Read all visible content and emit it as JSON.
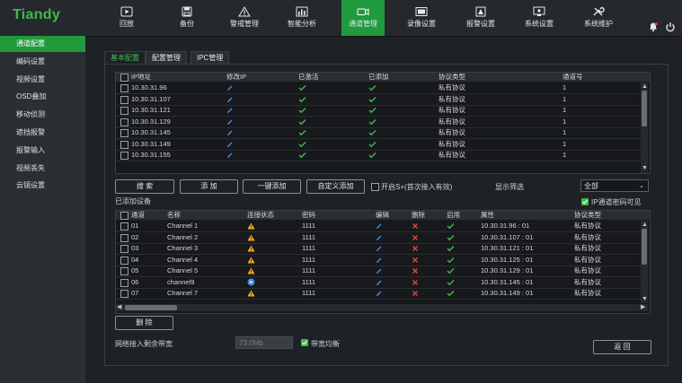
{
  "app": {
    "logo": "Tiandy"
  },
  "nav": {
    "items": [
      {
        "label": "回放",
        "icon": "playback-icon"
      },
      {
        "label": "备份",
        "icon": "save-icon"
      },
      {
        "label": "警戒管理",
        "icon": "alarm-icon"
      },
      {
        "label": "智能分析",
        "icon": "analysis-icon"
      },
      {
        "label": "通道管理",
        "icon": "camera-icon",
        "active": true
      },
      {
        "label": "录像设置",
        "icon": "record-icon"
      },
      {
        "label": "报警设置",
        "icon": "alarm-settings-icon"
      },
      {
        "label": "系统设置",
        "icon": "system-icon"
      },
      {
        "label": "系统维护",
        "icon": "maintenance-icon"
      }
    ],
    "bell_icon": "bell-icon",
    "power_icon": "power-icon"
  },
  "sidebar": {
    "items": [
      "通道配置",
      "编码设置",
      "视频设置",
      "OSD叠加",
      "移动侦测",
      "遮挡报警",
      "报警输入",
      "视频丢失",
      "云镜设置"
    ]
  },
  "tabs": [
    "基本配置",
    "配置管理",
    "IPC管理"
  ],
  "discovered": {
    "headers": [
      "IP地址",
      "修改IP",
      "已激活",
      "已添加",
      "协议类型",
      "通道号"
    ],
    "rows": [
      {
        "ip": "10.30.31.96",
        "protocol": "私有协议",
        "channel": "1"
      },
      {
        "ip": "10.30.31.107",
        "protocol": "私有协议",
        "channel": "1"
      },
      {
        "ip": "10.30.31.121",
        "protocol": "私有协议",
        "channel": "1"
      },
      {
        "ip": "10.30.31.129",
        "protocol": "私有协议",
        "channel": "1"
      },
      {
        "ip": "10.30.31.145",
        "protocol": "私有协议",
        "channel": "1"
      },
      {
        "ip": "10.30.31.149",
        "protocol": "私有协议",
        "channel": "1"
      },
      {
        "ip": "10.30.31.155",
        "protocol": "私有协议",
        "channel": "1"
      }
    ]
  },
  "buttons": {
    "search": "搜 索",
    "add": "添 加",
    "one_click_add": "一键添加",
    "custom_add": "自定义添加",
    "delete": "删 除",
    "back": "返 回"
  },
  "options": {
    "enable_s_plus": "开启S+(首次接入有效)",
    "display_filter": "显示筛选",
    "filter_value": "全部",
    "ip_password_visible": "IP通道密码可见",
    "bandwidth_balance": "带宽均衡"
  },
  "added": {
    "title": "已添加设备",
    "headers": [
      "通道",
      "名称",
      "连接状态",
      "密码",
      "编辑",
      "删除",
      "启用",
      "属性",
      "协议类型"
    ],
    "rows": [
      {
        "ch": "01",
        "name": "Channel 1",
        "status": "warning",
        "password": "1111",
        "attr": "10.30.31.96 : 01",
        "protocol": "私有协议"
      },
      {
        "ch": "02",
        "name": "Channel 2",
        "status": "warning",
        "password": "1111",
        "attr": "10.30.31.107 : 01",
        "protocol": "私有协议"
      },
      {
        "ch": "03",
        "name": "Channel 3",
        "status": "warning",
        "password": "1111",
        "attr": "10.30.31.121 : 01",
        "protocol": "私有协议"
      },
      {
        "ch": "04",
        "name": "Channel 4",
        "status": "warning",
        "password": "1111",
        "attr": "10.30.31.125 : 01",
        "protocol": "私有协议"
      },
      {
        "ch": "05",
        "name": "Channel 5",
        "status": "warning",
        "password": "1111",
        "attr": "10.30.31.129 : 01",
        "protocol": "私有协议"
      },
      {
        "ch": "06",
        "name": "channel9",
        "status": "playing",
        "password": "1111",
        "attr": "10.30.31.145 : 01",
        "protocol": "私有协议"
      },
      {
        "ch": "07",
        "name": "Channel 7",
        "status": "warning",
        "password": "1111",
        "attr": "10.30.31.149 : 01",
        "protocol": "私有协议"
      }
    ]
  },
  "bandwidth": {
    "label": "网络接入剩余带宽",
    "value": "73.0Mb"
  },
  "colors": {
    "accent": "#1f9a3d",
    "check": "#3dbb4a",
    "warning": "#f2b01e",
    "delete": "#e0463c",
    "edit": "#3f8ee8"
  }
}
